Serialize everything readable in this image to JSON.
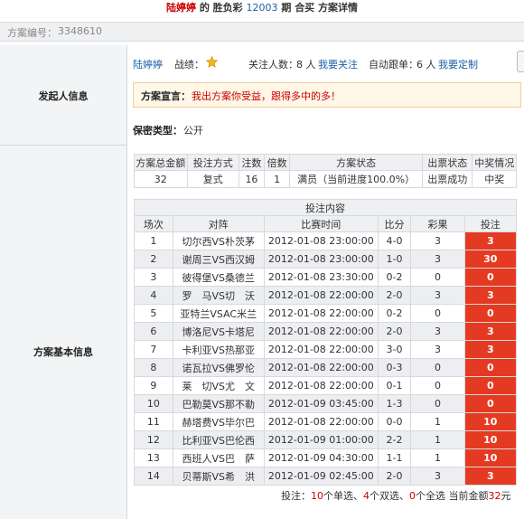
{
  "header": {
    "user": "陆婷婷",
    "de": "的",
    "lottery": "胜负彩",
    "period": "12003",
    "qi": "期",
    "mode": "合买",
    "suffix": "方案详情"
  },
  "scheme_id": {
    "label": "方案编号：",
    "value": "3348610"
  },
  "sponsor": {
    "section_label": "发起人信息",
    "name": "陆婷婷",
    "record_label": "战绩：",
    "follow_label": "关注人数：",
    "follow_count": "8 人",
    "follow_link": "我要关注",
    "auto_label": "自动跟单：",
    "auto_count": "6 人",
    "auto_link": "我要定制",
    "decl_label": "方案宣言：",
    "decl_text": "我出方案你受益，跟得多中的多！",
    "secret_label": "保密类型：",
    "secret_value": "公开"
  },
  "basic": {
    "section_label": "方案基本信息",
    "summary_headers": [
      "方案总金额",
      "投注方式",
      "注数",
      "倍数",
      "方案状态",
      "出票状态",
      "中奖情况"
    ],
    "summary_values": [
      "32",
      "复式",
      "16",
      "1",
      "满员（当前进度100.0%）",
      "出票成功",
      "中奖"
    ],
    "bet_caption": "投注内容",
    "bet_headers": [
      "场次",
      "对阵",
      "比赛时间",
      "比分",
      "彩果",
      "投注"
    ],
    "rows": [
      {
        "n": "1",
        "match": "切尔西VS朴茨茅",
        "time": "2012-01-08 23:00:00",
        "score": "4-0",
        "result": "3",
        "bet": "3",
        "hit": true
      },
      {
        "n": "2",
        "match": "谢周三VS西汉姆",
        "time": "2012-01-08 23:00:00",
        "score": "1-0",
        "result": "3",
        "bet": "30",
        "hit": true
      },
      {
        "n": "3",
        "match": "彼得堡VS桑德兰",
        "time": "2012-01-08 23:30:00",
        "score": "0-2",
        "result": "0",
        "bet": "0",
        "hit": true
      },
      {
        "n": "4",
        "match": "罗　马VS切　沃",
        "time": "2012-01-08 22:00:00",
        "score": "2-0",
        "result": "3",
        "bet": "3",
        "hit": true
      },
      {
        "n": "5",
        "match": "亚特兰VSAC米兰",
        "time": "2012-01-08 22:00:00",
        "score": "0-2",
        "result": "0",
        "bet": "0",
        "hit": true
      },
      {
        "n": "6",
        "match": "博洛尼VS卡塔尼",
        "time": "2012-01-08 22:00:00",
        "score": "2-0",
        "result": "3",
        "bet": "3",
        "hit": true
      },
      {
        "n": "7",
        "match": "卡利亚VS热那亚",
        "time": "2012-01-08 22:00:00",
        "score": "3-0",
        "result": "3",
        "bet": "3",
        "hit": true
      },
      {
        "n": "8",
        "match": "诺瓦拉VS佛罗伦",
        "time": "2012-01-08 22:00:00",
        "score": "0-3",
        "result": "0",
        "bet": "0",
        "hit": true
      },
      {
        "n": "9",
        "match": "莱　切VS尤　文",
        "time": "2012-01-08 22:00:00",
        "score": "0-1",
        "result": "0",
        "bet": "0",
        "hit": true
      },
      {
        "n": "10",
        "match": "巴勒莫VS那不勒",
        "time": "2012-01-09 03:45:00",
        "score": "1-3",
        "result": "0",
        "bet": "0",
        "hit": true
      },
      {
        "n": "11",
        "match": "赫塔费VS毕尔巴",
        "time": "2012-01-08 22:00:00",
        "score": "0-0",
        "result": "1",
        "bet": "10",
        "hit": true
      },
      {
        "n": "12",
        "match": "比利亚VS巴伦西",
        "time": "2012-01-09 01:00:00",
        "score": "2-2",
        "result": "1",
        "bet": "10",
        "hit": true
      },
      {
        "n": "13",
        "match": "西班人VS巴　萨",
        "time": "2012-01-09 04:30:00",
        "score": "1-1",
        "result": "1",
        "bet": "10",
        "hit": true
      },
      {
        "n": "14",
        "match": "贝蒂斯VS希　洪",
        "time": "2012-01-09 02:45:00",
        "score": "2-0",
        "result": "3",
        "bet": "3",
        "hit": true
      }
    ],
    "footer": {
      "p1": "投注：",
      "single": "10",
      "p2": "个单选、",
      "double": "4",
      "p3": "个双选、",
      "full": "0",
      "p4": "个全选 当前金额",
      "amount": "32",
      "p5": "元"
    }
  },
  "colors": {
    "accent": "#c00000",
    "bet_cell": "#e53a22",
    "link": "#1c5fa8"
  }
}
